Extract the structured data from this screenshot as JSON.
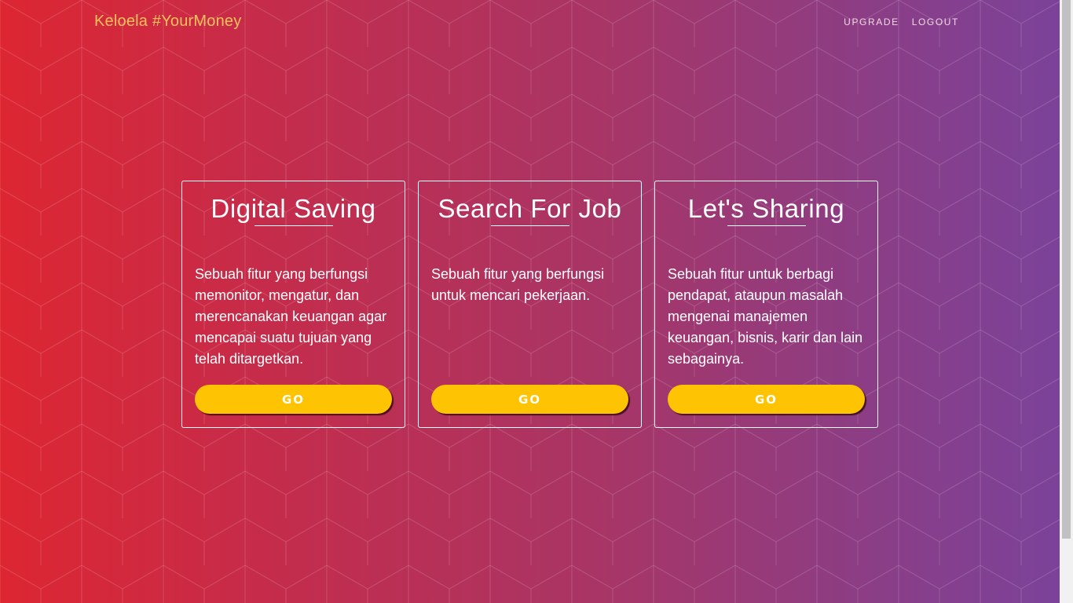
{
  "navbar": {
    "brand": "Keloela #YourMoney",
    "links": [
      {
        "label": "UPGRADE"
      },
      {
        "label": "LOGOUT"
      }
    ]
  },
  "cards": [
    {
      "title": "Digital Saving",
      "description": "Sebuah fitur yang berfungsi memonitor, mengatur, dan merencanakan keuangan agar mencapai suatu tujuan yang telah ditargetkan.",
      "button_label": "GO"
    },
    {
      "title": "Search For Job",
      "description": "Sebuah fitur yang berfungsi untuk mencari pekerjaan.",
      "button_label": "GO"
    },
    {
      "title": "Let's Sharing",
      "description": "Sebuah fitur untuk berbagi pendapat, ataupun masalah mengenai manajemen keuangan, bisnis, karir dan lain sebagainya.",
      "button_label": "GO"
    }
  ],
  "colors": {
    "gradient_left": "#dd2632",
    "gradient_right": "#7a439b",
    "brand": "#f5c15a",
    "button": "#fec302",
    "card_border": "#ffffff"
  }
}
